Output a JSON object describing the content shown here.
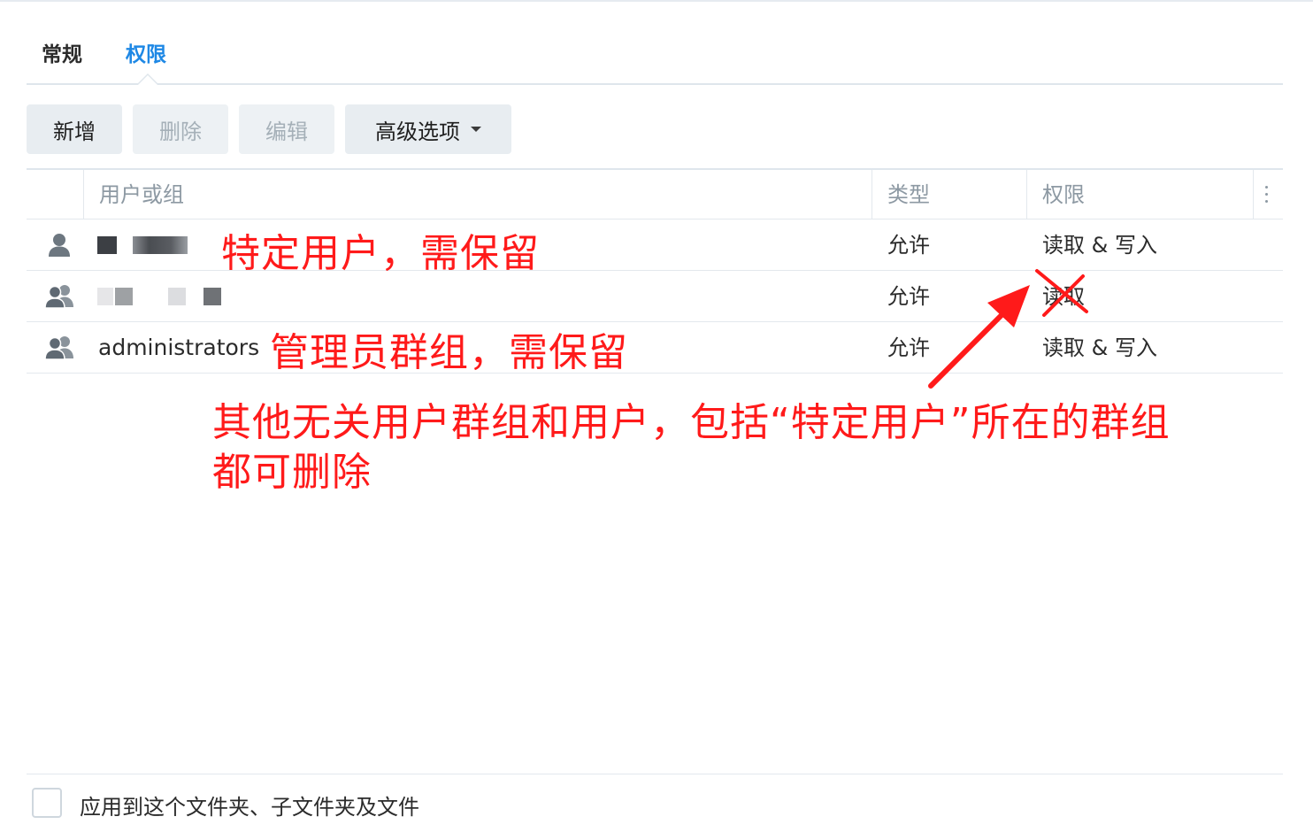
{
  "tabs": [
    {
      "label": "常规",
      "active": false
    },
    {
      "label": "权限",
      "active": true
    }
  ],
  "toolbar": {
    "add_label": "新增",
    "delete_label": "删除",
    "edit_label": "编辑",
    "advanced_label": "高级选项"
  },
  "table": {
    "columns": {
      "user_or_group": "用户或组",
      "type": "类型",
      "permission": "权限"
    },
    "rows": [
      {
        "icon": "user-icon",
        "name": "",
        "type": "允许",
        "permission": "读取 & 写入"
      },
      {
        "icon": "group-icon",
        "name": "",
        "type": "允许",
        "permission": "读取"
      },
      {
        "icon": "group-icon",
        "name": "administrators",
        "type": "允许",
        "permission": "读取 & 写入"
      }
    ]
  },
  "annotations": {
    "specific_user": "特定用户，需保留",
    "admin_group": "管理员群组，需保留",
    "others_line1": "其他无关用户群组和用户，包括“特定用户”所在的群组",
    "others_line2": "都可删除"
  },
  "footer": {
    "apply_label": "应用到这个文件夹、子文件夹及文件",
    "checked": false
  },
  "colors": {
    "accent": "#1e88e5",
    "annotation": "#ff1a1a",
    "button_bg": "#e8edf1",
    "header_text": "#8d99a3"
  }
}
